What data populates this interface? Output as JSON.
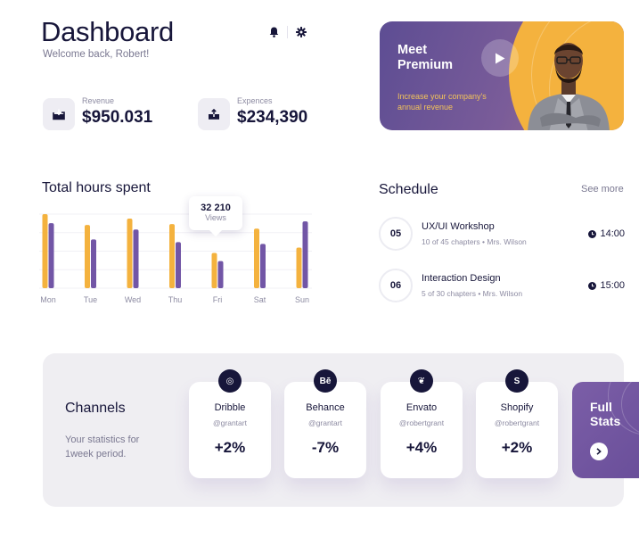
{
  "header": {
    "title": "Dashboard",
    "subtitle": "Welcome back, Robert!",
    "notification_icon": "bell-icon",
    "settings_icon": "gear-icon"
  },
  "stats": [
    {
      "label": "Revenue",
      "value": "$950.031",
      "icon": "download-tray-icon"
    },
    {
      "label": "Expences",
      "value": "$234,390",
      "icon": "upload-tray-icon"
    }
  ],
  "premium": {
    "title": "Meet Premium",
    "description": "Increase your company's annual revenue",
    "play_icon": "play-icon"
  },
  "hours": {
    "title": "Total hours spent",
    "tooltip_value": "32 210",
    "tooltip_label": "Views",
    "colors": {
      "primary": "#f4b23e",
      "secondary": "#7256a6"
    }
  },
  "chart_data": {
    "type": "bar",
    "title": "Total hours spent",
    "categories": [
      "Mon",
      "Tue",
      "Wed",
      "Thu",
      "Fri",
      "Sat",
      "Sun"
    ],
    "series": [
      {
        "values": [
          82,
          70,
          77,
          71,
          39,
          66,
          45
        ]
      },
      {
        "values": [
          72,
          54,
          65,
          51,
          30,
          49,
          74
        ]
      }
    ],
    "ylim": [
      0,
      82
    ],
    "grid": true,
    "annotation": {
      "category": "Fri",
      "value": "32 210",
      "label": "Views"
    }
  },
  "schedule": {
    "title": "Schedule",
    "see_more": "See more",
    "items": [
      {
        "date": "05",
        "name": "UX/UI Workshop",
        "meta": "10 of 45 chapters • Mrs. Wilson",
        "time": "14:00"
      },
      {
        "date": "06",
        "name": "Interaction Design",
        "meta": "5 of 30 chapters • Mrs. Wilson",
        "time": "15:00"
      }
    ]
  },
  "channels": {
    "title": "Channels",
    "description": "Your statistics for 1week  period.",
    "items": [
      {
        "name": "Dribble",
        "handle": "@grantart",
        "change": "+2%",
        "icon": "dribbble-icon",
        "glyph": "◎"
      },
      {
        "name": "Behance",
        "handle": "@grantart",
        "change": "-7%",
        "icon": "behance-icon",
        "glyph": "Bē"
      },
      {
        "name": "Envato",
        "handle": "@robertgrant",
        "change": "+4%",
        "icon": "envato-leaf-icon",
        "glyph": "❦"
      },
      {
        "name": "Shopify",
        "handle": "@robertgrant",
        "change": "+2%",
        "icon": "shopify-bag-icon",
        "glyph": "S"
      }
    ],
    "full_stats": "Full Stats",
    "full_stats_icon": "chevron-right-icon"
  }
}
